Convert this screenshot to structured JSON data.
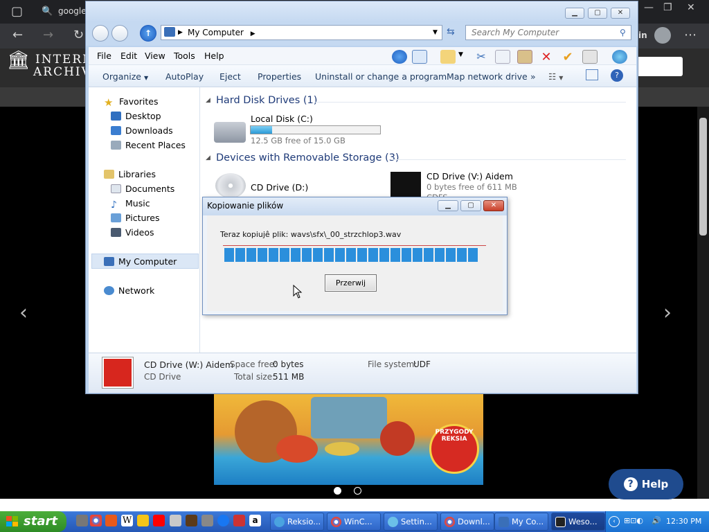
{
  "browser": {
    "tab_text": "google",
    "ia_logo_line1": "INTERNET",
    "ia_logo_line2": "ARCHIVE",
    "profile_badge": "in",
    "ia_search_text": "n"
  },
  "explorer": {
    "address": "My Computer",
    "search_placeholder": "Search My Computer",
    "menu": [
      "File",
      "Edit",
      "View",
      "Tools",
      "Help"
    ],
    "commands": [
      "Organize",
      "AutoPlay",
      "Eject",
      "Properties",
      "Uninstall or change a program",
      "Map network drive",
      "»"
    ],
    "nav": {
      "favorites": "Favorites",
      "favorites_items": [
        "Desktop",
        "Downloads",
        "Recent Places"
      ],
      "libraries": "Libraries",
      "libraries_items": [
        "Documents",
        "Music",
        "Pictures",
        "Videos"
      ],
      "my_computer": "My Computer",
      "network": "Network"
    },
    "groups": {
      "hdd_header": "Hard Disk Drives (1)",
      "local_disk_name": "Local Disk (C:)",
      "local_disk_free": "12.5 GB free of 15.0 GB",
      "local_disk_used_fraction": 0.1667,
      "removable_header": "Devices with Removable Storage (3)",
      "cd_d_name": "CD Drive (D:)",
      "cd_v_name": "CD Drive (V:) Aidem",
      "cd_v_free": "0 bytes free of 611 MB",
      "cd_v_fs": "CDFS"
    },
    "details": {
      "name": "CD Drive (W:) Aidem",
      "type": "CD Drive",
      "space_free_label": "Space free:",
      "space_free_value": "0 bytes",
      "total_size_label": "Total size:",
      "total_size_value": "511 MB",
      "fs_label": "File system:",
      "fs_value": "UDF"
    }
  },
  "dialog": {
    "title": "Kopiowanie plików",
    "message": "Teraz kopiujê plik: wavs\\sfx\\_00_strzchlop3.wav",
    "cancel_label": "Przerwij",
    "progress_blocks": 23
  },
  "page": {
    "help_label": "Help",
    "cover_badge": "PRZYGODY REKSIA"
  },
  "taskbar": {
    "start_label": "start",
    "tasks": [
      "Reksio...",
      "WinC...",
      "Settin...",
      "Downl...",
      "My Co...",
      "Weso..."
    ],
    "clock": "12:30 PM"
  },
  "colors": {
    "accent": "#2b8fdc",
    "window_frame": "#bcd3ee",
    "taskbar": "#2457b5",
    "start_green": "#3a9e2e"
  }
}
